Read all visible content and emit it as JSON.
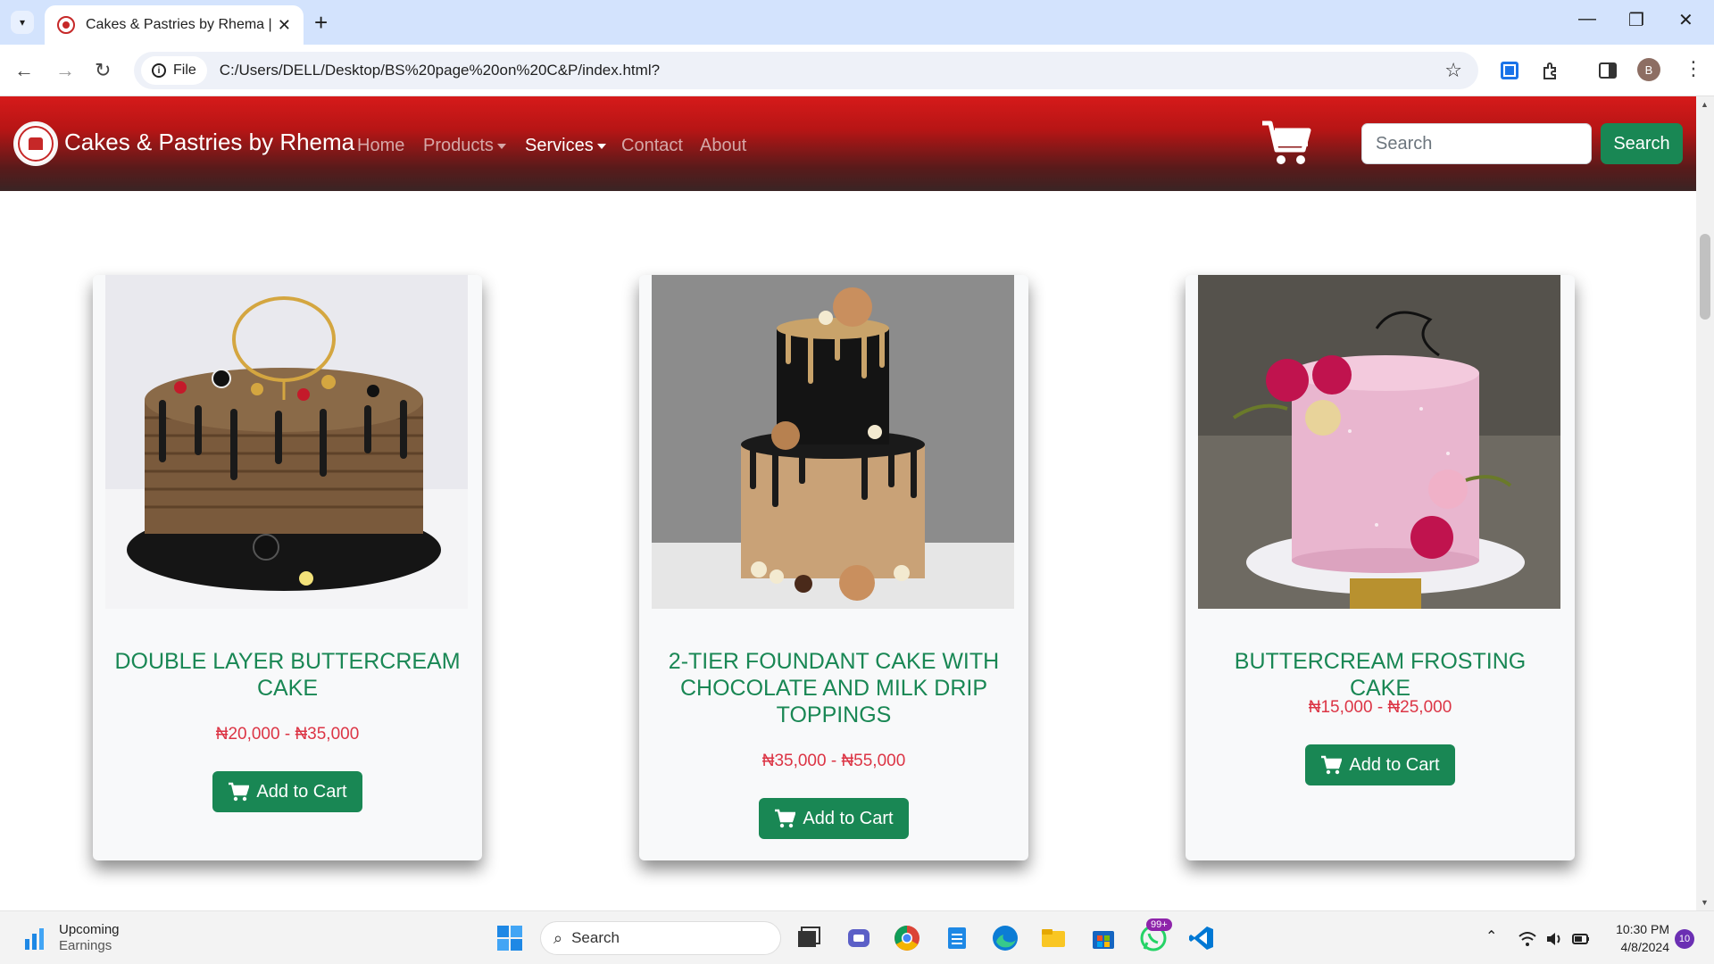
{
  "browser": {
    "tab_title": "Cakes & Pastries by Rhema | Gr",
    "url_chip": "File",
    "url": "C:/Users/DELL/Desktop/BS%20page%20on%20C&P/index.html?",
    "profile_initial": "B"
  },
  "site": {
    "brand": "Cakes & Pastries by Rhema",
    "nav": {
      "home": "Home",
      "products": "Products",
      "services": "Services",
      "contact": "Contact",
      "about": "About"
    },
    "search_placeholder": "Search",
    "search_button": "Search",
    "colors": {
      "accent_green": "#198754",
      "price_red": "#dc3545",
      "navbar_red": "#d61a1a"
    }
  },
  "products": [
    {
      "title": "DOUBLE LAYER BUTTERCREAM CAKE",
      "price": "₦20,000 - ₦35,000",
      "button": "Add to Cart"
    },
    {
      "title": "2-TIER FOUNDANT CAKE WITH CHOCOLATE AND MILK DRIP TOPPINGS",
      "price": "₦35,000 - ₦55,000",
      "button": "Add to Cart"
    },
    {
      "title": "BUTTERCREAM FROSTING CAKE",
      "price": "₦15,000 - ₦25,000",
      "button": "Add to Cart"
    }
  ],
  "taskbar": {
    "weather_title": "Upcoming",
    "weather_sub": "Earnings",
    "search": "Search",
    "whatsapp_badge": "99+",
    "time": "10:30 PM",
    "date": "4/8/2024",
    "notifications": "10"
  }
}
